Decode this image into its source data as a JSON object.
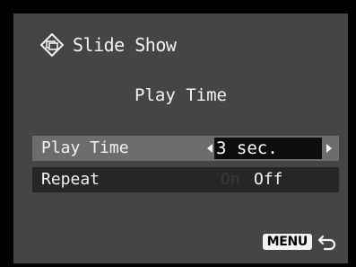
{
  "header": {
    "title": "Slide Show",
    "icon": "slideshow-icon"
  },
  "section_title": "Play Time",
  "menu_rows": [
    {
      "label": "Play Time",
      "value": "3 sec."
    },
    {
      "label": "Repeat",
      "options": [
        "On",
        "Off"
      ],
      "selected": "Off"
    }
  ],
  "footer": {
    "menu_label": "MENU",
    "return_icon": "return-icon"
  },
  "colors": {
    "screen_bg": "#454545",
    "row_bg": "#262626",
    "selected_row_bg": "#6d6d6d",
    "value_box_bg": "#0d0d0d"
  }
}
